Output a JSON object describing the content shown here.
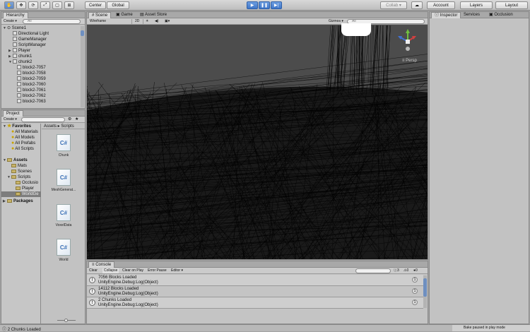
{
  "toolbar": {
    "center": "Center",
    "global": "Global",
    "collab": "Collab ▾",
    "account": "Account",
    "layers": "Layers",
    "layout": "Layout"
  },
  "hierarchy": {
    "tab": "Hierarchy",
    "create": "Create ▾",
    "search": "All",
    "scene": "Scene1",
    "items": [
      "Directional Light",
      "GameManager",
      "ScriptManager",
      "Player",
      "chunk1",
      "chunk2",
      "block2-7057",
      "block2-7058",
      "block2-7059",
      "block2-7060",
      "block2-7061",
      "block2-7062",
      "block2-7063"
    ]
  },
  "scene": {
    "tabs": [
      "Scene",
      "Game",
      "Asset Store"
    ],
    "shading": "Wireframe",
    "mode2d": "2D",
    "gizmos": "Gizmos ▾",
    "search": "All",
    "persp": "Persp"
  },
  "inspector": {
    "tabs": [
      "Inspector",
      "Services",
      "Occlusion"
    ]
  },
  "project": {
    "tab": "Project",
    "create": "Create ▾",
    "favorites": "Favorites",
    "fav_items": [
      "All Materials",
      "All Models",
      "All Prefabs",
      "All Scripts"
    ],
    "assets": "Assets",
    "tree": [
      "Mats",
      "Scenes",
      "Scripts",
      "Occlusio",
      "Player",
      "WorldGe"
    ],
    "packages": "Packages",
    "breadcrumb": [
      "Assets",
      "Scripts"
    ],
    "files": [
      "Chunk",
      "MeshGenerat...",
      "VoxelData",
      "World"
    ],
    "file_icon_text": "C#"
  },
  "console": {
    "tab": "Console",
    "buttons": [
      "Clear",
      "Collapse",
      "Clear on Play",
      "Error Pause",
      "Editor ▾"
    ],
    "counts": [
      "3",
      "0",
      "0"
    ],
    "logs": [
      {
        "line1": "7056 Blocks Loaded",
        "line2": "UnityEngine.Debug:Log(Object)",
        "count": "1"
      },
      {
        "line1": "14112 Blocks Loaded",
        "line2": "UnityEngine.Debug:Log(Object)",
        "count": "1"
      },
      {
        "line1": "2 Chunks Loaded",
        "line2": "UnityEngine.Debug:Log(Object)",
        "count": "1"
      }
    ]
  },
  "status": {
    "message": "2 Chunks Loaded",
    "right": "Bake paused in play mode"
  }
}
